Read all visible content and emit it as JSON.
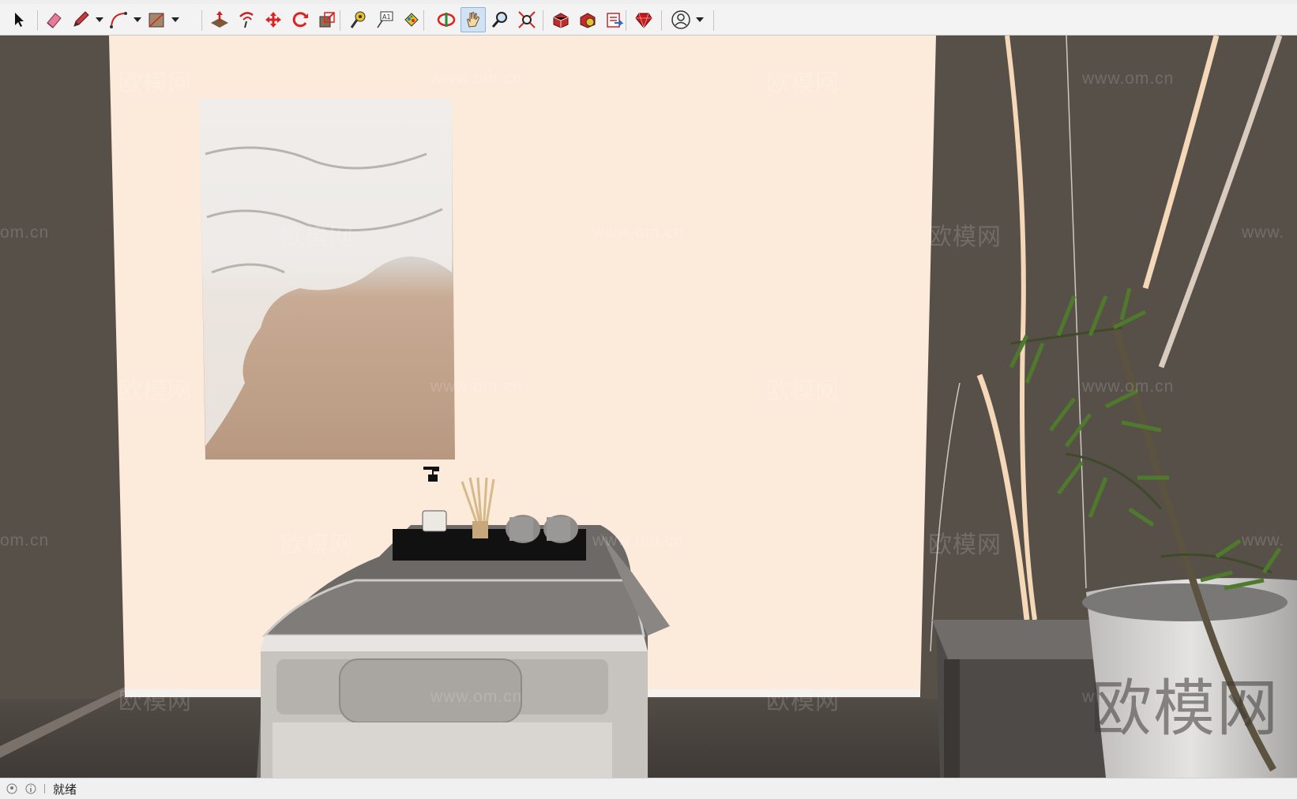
{
  "toolbar": {
    "groups": [
      {
        "tools": [
          {
            "name": "select-tool",
            "icon": "arrow-cursor-icon"
          }
        ]
      },
      {
        "tools": [
          {
            "name": "eraser-tool",
            "icon": "eraser-icon"
          },
          {
            "name": "line-tool",
            "icon": "pencil-icon",
            "dropdown": true
          },
          {
            "name": "arc-tool",
            "icon": "arc-icon",
            "dropdown": true
          },
          {
            "name": "shape-tool",
            "icon": "rectangle-icon",
            "dropdown": true
          }
        ]
      },
      {
        "tools": [
          {
            "name": "push-pull-tool",
            "icon": "push-pull-icon"
          },
          {
            "name": "offset-tool",
            "icon": "offset-icon"
          },
          {
            "name": "move-tool",
            "icon": "move-arrows-icon"
          },
          {
            "name": "rotate-tool",
            "icon": "rotate-icon"
          },
          {
            "name": "scale-tool",
            "icon": "scale-icon"
          }
        ]
      },
      {
        "tools": [
          {
            "name": "tape-measure-tool",
            "icon": "tape-measure-icon"
          },
          {
            "name": "text-tool",
            "icon": "text-label-icon"
          },
          {
            "name": "paint-bucket-tool",
            "icon": "paint-bucket-icon"
          }
        ]
      },
      {
        "tools": [
          {
            "name": "orbit-tool",
            "icon": "orbit-icon"
          },
          {
            "name": "pan-tool",
            "icon": "hand-icon",
            "active": true
          },
          {
            "name": "zoom-tool",
            "icon": "magnifier-icon"
          },
          {
            "name": "zoom-extents-tool",
            "icon": "zoom-extents-icon"
          }
        ]
      },
      {
        "tools": [
          {
            "name": "warehouse-button",
            "icon": "3d-warehouse-icon"
          },
          {
            "name": "extension-warehouse-button",
            "icon": "extension-warehouse-icon"
          },
          {
            "name": "layout-button",
            "icon": "send-to-layout-icon"
          }
        ]
      },
      {
        "tools": [
          {
            "name": "ruby-console-button",
            "icon": "ruby-gem-icon"
          }
        ]
      },
      {
        "tools": [
          {
            "name": "account-button",
            "icon": "user-account-icon",
            "dropdown": true
          }
        ]
      }
    ]
  },
  "status": {
    "text": "就绪"
  },
  "watermarks": {
    "logo": "欧模网",
    "url": "www.om.cn",
    "url_cut": "om.cn",
    "url_cut_right": "www."
  },
  "colors": {
    "accent": "#2e8fd6",
    "active_tool_bg": "#cfe3f5",
    "wall": "#fcebdb",
    "side_wall": "#575049",
    "floor": "#4a4541"
  }
}
